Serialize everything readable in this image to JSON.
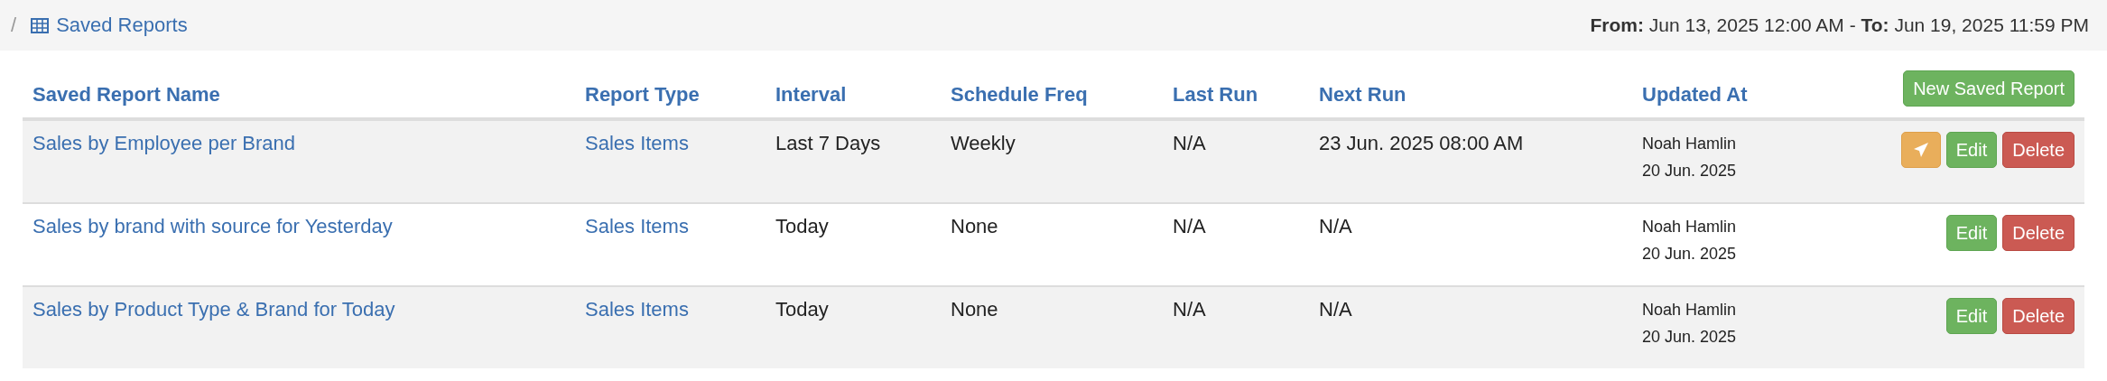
{
  "breadcrumb": {
    "separator": "/",
    "current": "Saved Reports"
  },
  "date_range": {
    "from_label": "From:",
    "from": "Jun 13, 2025 12:00 AM",
    "dash": "-",
    "to_label": "To:",
    "to": "Jun 19, 2025 11:59 PM"
  },
  "table": {
    "columns": [
      "Saved Report Name",
      "Report Type",
      "Interval",
      "Schedule Freq",
      "Last Run",
      "Next Run",
      "Updated At"
    ],
    "new_button": "New Saved Report",
    "rows": [
      {
        "name": "Sales by Employee per Brand",
        "type": "Sales Items",
        "interval": "Last 7 Days",
        "schedule": "Weekly",
        "last_run": "N/A",
        "next_run": "23 Jun. 2025 08:00 AM",
        "updated_by": "Noah Hamlin",
        "updated_on": "20 Jun. 2025",
        "send_button": true,
        "edit": "Edit",
        "delete": "Delete"
      },
      {
        "name": "Sales by brand with source for Yesterday",
        "type": "Sales Items",
        "interval": "Today",
        "schedule": "None",
        "last_run": "N/A",
        "next_run": "N/A",
        "updated_by": "Noah Hamlin",
        "updated_on": "20 Jun. 2025",
        "send_button": false,
        "edit": "Edit",
        "delete": "Delete"
      },
      {
        "name": "Sales by Product Type & Brand for Today",
        "type": "Sales Items",
        "interval": "Today",
        "schedule": "None",
        "last_run": "N/A",
        "next_run": "N/A",
        "updated_by": "Noah Hamlin",
        "updated_on": "20 Jun. 2025",
        "send_button": false,
        "edit": "Edit",
        "delete": "Delete"
      }
    ]
  }
}
